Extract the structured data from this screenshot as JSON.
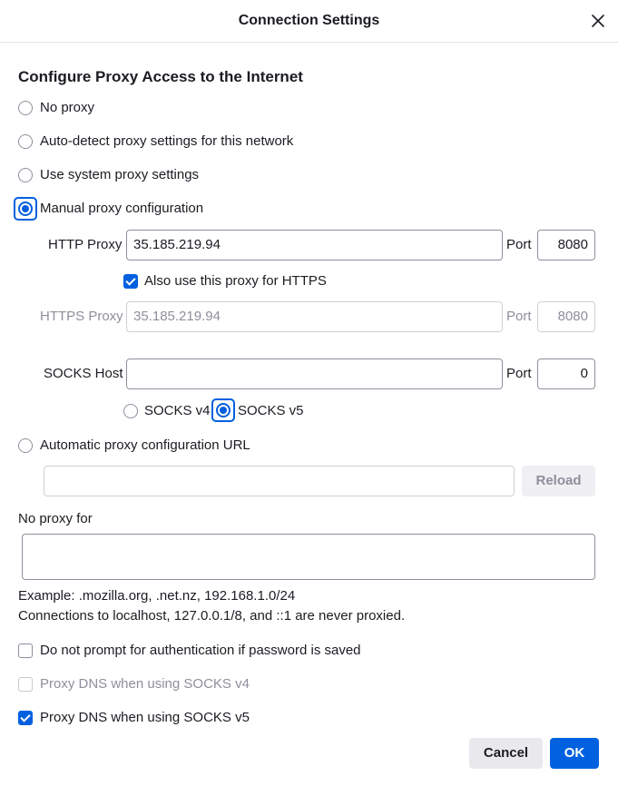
{
  "dialog": {
    "title": "Connection Settings"
  },
  "section_heading": "Configure Proxy Access to the Internet",
  "proxy_modes": {
    "no_proxy": "No proxy",
    "auto_detect": "Auto-detect proxy settings for this network",
    "system": "Use system proxy settings",
    "manual": "Manual proxy configuration",
    "selected": "manual"
  },
  "http": {
    "label": "HTTP Proxy",
    "value": "35.185.219.94",
    "port_label": "Port",
    "port": "8080"
  },
  "also_https": {
    "label": "Also use this proxy for HTTPS",
    "checked": true
  },
  "https": {
    "label": "HTTPS Proxy",
    "value": "35.185.219.94",
    "port_label": "Port",
    "port": "8080"
  },
  "socks": {
    "label": "SOCKS Host",
    "value": "",
    "port_label": "Port",
    "port": "0",
    "v4": "SOCKS v4",
    "v5": "SOCKS v5",
    "selected": "v5"
  },
  "auto_url": {
    "label": "Automatic proxy configuration URL",
    "value": "",
    "reload": "Reload"
  },
  "no_proxy_for": {
    "label": "No proxy for",
    "value": ""
  },
  "help": {
    "example": "Example: .mozilla.org, .net.nz, 192.168.1.0/24",
    "note": "Connections to localhost, 127.0.0.1/8, and ::1 are never proxied."
  },
  "options": {
    "no_prompt": {
      "label": "Do not prompt for authentication if password is saved",
      "checked": false
    },
    "dns_v4": {
      "label": "Proxy DNS when using SOCKS v4",
      "checked": false
    },
    "dns_v5": {
      "label": "Proxy DNS when using SOCKS v5",
      "checked": true
    }
  },
  "buttons": {
    "cancel": "Cancel",
    "ok": "OK"
  },
  "colors": {
    "accent": "#0060df",
    "text": "#1c1b22",
    "muted": "#8f8f9d"
  },
  "icons": {
    "close": "close-icon"
  }
}
